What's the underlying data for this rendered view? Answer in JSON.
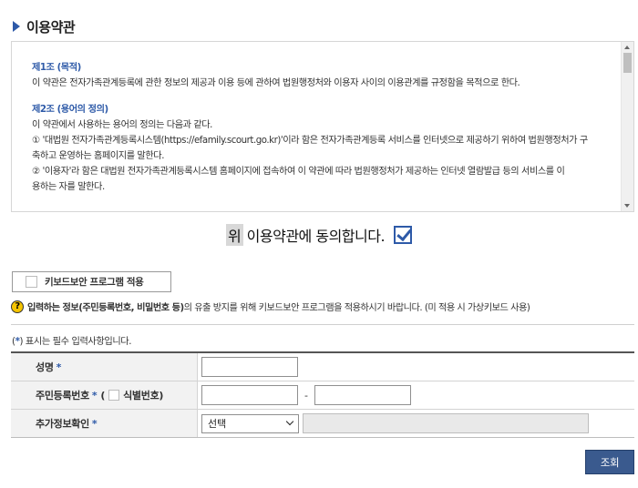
{
  "section": {
    "title": "이용약관"
  },
  "terms": {
    "article1": {
      "title": "제1조 (목적)",
      "body": "이 약관은 전자가족관계등록에 관한 정보의 제공과 이용 등에 관하여 법원행정처와 이용자 사이의 이용관계를 규정함을 목적으로 한다."
    },
    "article2": {
      "title": "제2조 (용어의 정의)",
      "intro": "이 약관에서 사용하는 용어의 정의는 다음과 같다.",
      "item1_line1": "① '대법원 전자가족관계등록시스템(https://efamily.scourt.go.kr)'이라 함은 전자가족관계등록 서비스를 인터넷으로 제공하기 위하여 법원행정처가 구",
      "item1_line2": "축하고 운영하는 홈페이지를 말한다.",
      "item2_line1": "② '이용자'라 함은 대법원 전자가족관계등록시스템 홈페이지에 접속하여 이 약관에 따라 법원행정처가 제공하는 인터넷 열람발급 등의 서비스를 이",
      "item2_line2": "용하는 자를 말한다."
    }
  },
  "agree": {
    "highlight": "위",
    "text": "이용약관에 동의합니다.",
    "checked": true
  },
  "keyboard_security": {
    "label": "키보드보안 프로그램 적용",
    "checked": false
  },
  "notice": {
    "icon": "?",
    "bold": "입력하는 정보(주민등록번호, 비밀번호 등)",
    "text": "의 유출 방지를 위해 키보드보안 프로그램을 적용하시기 바랍니다. (미 적용 시 가상키보드 사용)"
  },
  "required_note": {
    "prefix": "(",
    "star": "*",
    "suffix": ") 표시는 필수 입력사항입니다."
  },
  "form": {
    "name_label": "성명",
    "rrn_label": "주민등록번호",
    "rrn_open": "(",
    "rrn_id_label": "식별번호)",
    "extra_label": "추가정보확인",
    "required_mark": "*",
    "dash": "-",
    "select_value": "선택"
  },
  "search_button": "조회",
  "colors": {
    "accent": "#2e5aa8",
    "button": "#3a5a8e",
    "notice_icon": "#f5c400"
  }
}
